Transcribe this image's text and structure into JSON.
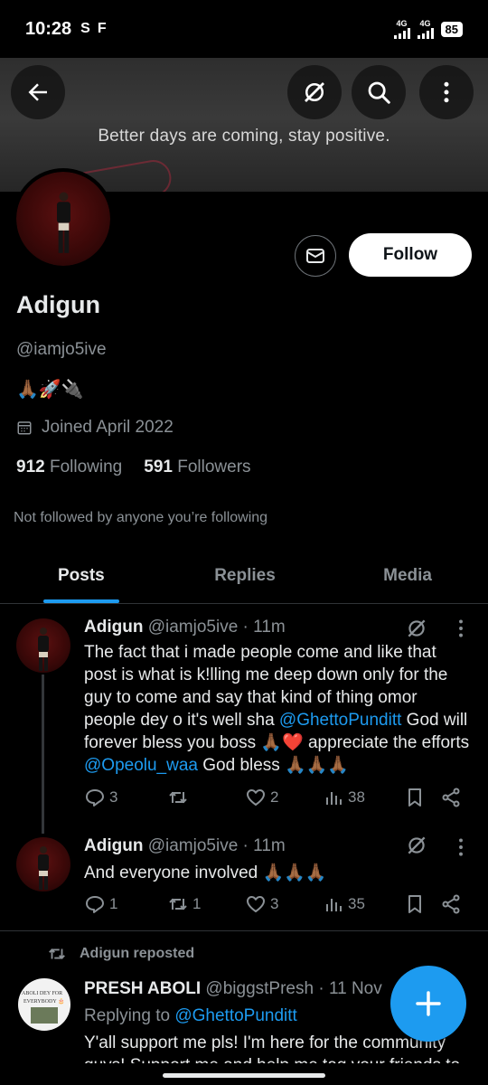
{
  "status_bar": {
    "time": "10:28",
    "left_icons": [
      "S",
      "F"
    ],
    "network1": "4G",
    "network2": "4G",
    "battery": "85"
  },
  "header": {
    "banner_text": "Better days are coming, stay positive.",
    "icons": [
      "back-arrow-icon",
      "grok-icon",
      "search-icon",
      "more-vertical-icon"
    ]
  },
  "profile": {
    "name": "Adigun",
    "handle": "@iamjo5ive",
    "bio": "🙏🏾🚀🔌",
    "joined": "Joined April 2022",
    "following_count": "912",
    "following_label": "Following",
    "followers_count": "591",
    "followers_label": "Followers",
    "not_followed": "Not followed by anyone you’re following",
    "follow_label": "Follow"
  },
  "tabs": [
    {
      "label": "Posts",
      "active": true
    },
    {
      "label": "Replies",
      "active": false
    },
    {
      "label": "Media",
      "active": false
    }
  ],
  "posts": [
    {
      "author": "Adigun",
      "handle": "@iamjo5ive",
      "sep": "·",
      "time": "11m",
      "text_1": "The fact that i made people come and like that post is what is k!lling me deep down only for the guy to come and say that kind of thing omor people dey o it's well sha ",
      "mention_1": "@GhettoPunditt",
      "text_2": " God will forever bless you boss 🙏🏾",
      "heart": "❤️",
      "text_3": " appreciate the efforts ",
      "mention_2": "@Opeolu_waa",
      "text_4": " God bless 🙏🏾🙏🏾🙏🏾",
      "replies": "3",
      "reposts": "",
      "likes": "2",
      "views": "38"
    },
    {
      "author": "Adigun",
      "handle": "@iamjo5ive",
      "sep": "·",
      "time": "11m",
      "text": "And everyone involved 🙏🏾🙏🏾🙏🏾",
      "replies": "1",
      "reposts": "1",
      "likes": "3",
      "views": "35"
    }
  ],
  "repost": {
    "note": "Adigun reposted",
    "author": "PRESH ABOLI",
    "handle": "@biggstPresh",
    "sep": "·",
    "time": "11 Nov",
    "replying_to_label": "Replying to ",
    "replying_to": "@GhettoPunditt",
    "text": "Y'all support me pls! I'm here for the community guys! Support me and help me tag your friends to",
    "avatar_text_1": "ABOLI DEY FOR",
    "avatar_text_2": "EVERYBODY 🎂"
  },
  "colors": {
    "accent": "#1d9bf0",
    "text_primary": "#e7e9ea",
    "text_secondary": "#8b9196",
    "background": "#000000"
  }
}
